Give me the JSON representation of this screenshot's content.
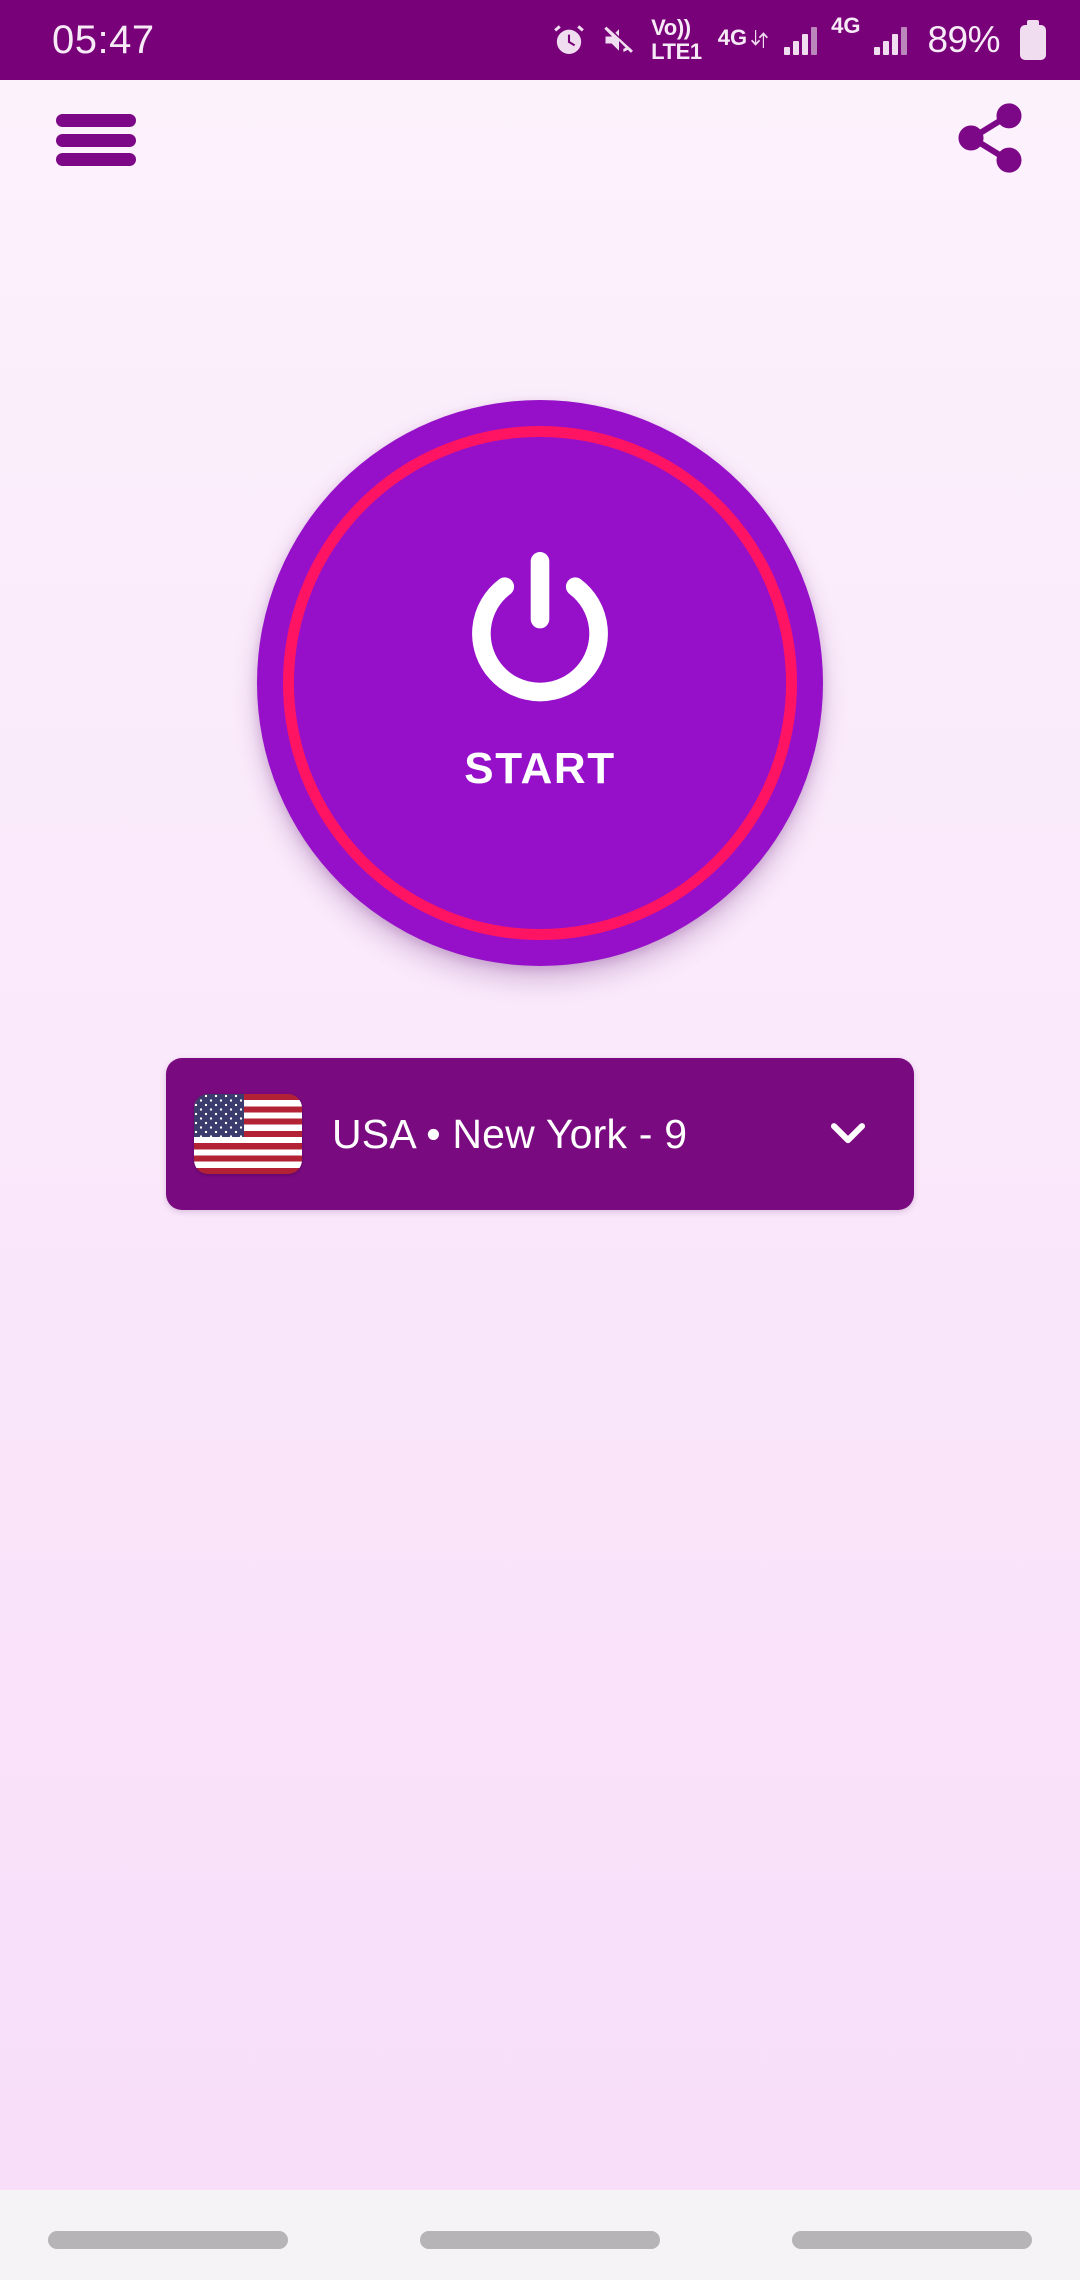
{
  "status_bar": {
    "time": "05:47",
    "background_color": "#780078",
    "icons": [
      {
        "name": "alarm-icon",
        "label": ""
      },
      {
        "name": "mute-icon",
        "label": ""
      }
    ],
    "volte": {
      "line1": "Vo))",
      "line2": "LTE1"
    },
    "sim1": {
      "network": "4G",
      "data_arrows": "↓↑"
    },
    "sim2": {
      "network": "4G"
    },
    "battery": {
      "percent": "89%"
    }
  },
  "app_bar": {
    "menu_icon": "hamburger-menu-icon",
    "share_icon": "share-icon",
    "icon_color": "#7d0887"
  },
  "connection": {
    "button_label": "START",
    "state": "disconnected",
    "power_icon": "power-icon",
    "button_color": "#9510c8",
    "ring_color": "#ff1464",
    "label_color": "#ffffff"
  },
  "server_selector": {
    "flag": "us-flag-icon",
    "flag_country_code": "US",
    "label": "USA • New York - 9",
    "country": "USA",
    "city": "New York",
    "server_number": "9",
    "chevron_icon": "chevron-down-icon",
    "background_color": "#7a0a80",
    "text_color": "#ffffff"
  },
  "theme": {
    "page_background_top": "#fcf3fc",
    "page_background_bottom": "#f8ddf9",
    "accent_purple": "#9510c8",
    "accent_pink": "#ff1464",
    "dark_purple": "#7a0a80"
  },
  "nav_bar": {
    "background_color": "#f5f3f5",
    "pills": [
      "recents-pill",
      "home-pill",
      "back-pill"
    ]
  }
}
